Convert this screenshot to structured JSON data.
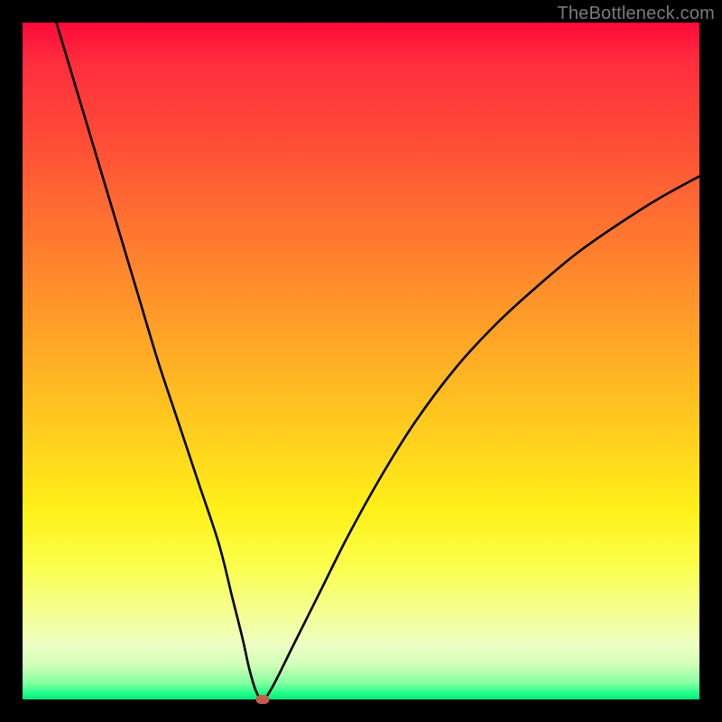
{
  "watermark": "TheBottleneck.com",
  "chart_data": {
    "type": "line",
    "title": "",
    "xlabel": "",
    "ylabel": "",
    "xlim": [
      0,
      100
    ],
    "ylim": [
      0,
      100
    ],
    "grid": false,
    "series": [
      {
        "name": "curve",
        "x": [
          5,
          8,
          11,
          14,
          17,
          20,
          23,
          26,
          29,
          31,
          32.5,
          33.5,
          34.5,
          35.5,
          37,
          40,
          44,
          48,
          53,
          58,
          64,
          70,
          76,
          82,
          88,
          94,
          100
        ],
        "values": [
          100,
          90,
          80,
          70,
          60,
          50,
          41,
          32,
          23,
          15,
          9,
          4.5,
          1.2,
          0,
          2,
          8,
          16,
          24,
          33,
          41,
          49,
          55.5,
          61,
          66,
          70.2,
          74,
          77.3
        ]
      }
    ],
    "min_marker": {
      "x": 35.5,
      "y": 0,
      "color": "#c55a4e"
    },
    "gradient_stops": [
      {
        "pos": 0,
        "color": "#ff0a3a"
      },
      {
        "pos": 0.5,
        "color": "#ffaf24"
      },
      {
        "pos": 0.78,
        "color": "#fbff4a"
      },
      {
        "pos": 1.0,
        "color": "#00e87a"
      }
    ]
  }
}
